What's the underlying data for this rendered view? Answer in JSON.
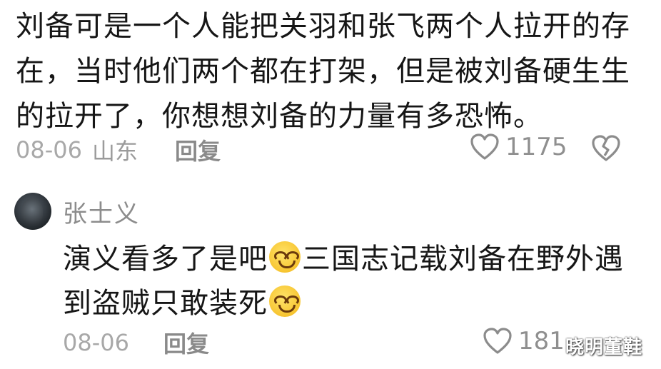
{
  "comment": {
    "text": "刘备可是一个人能把关羽和张飞两个人拉开的存在，当时他们两个都在打架，但是被刘备硬生生的拉开了，你想想刘备的力量有多恐怖。",
    "date": "08-06",
    "location": "山东",
    "reply_label": "回复",
    "like_count": "1175",
    "like_icon": "heart-outline-icon",
    "dislike_icon": "broken-heart-icon"
  },
  "reply": {
    "username": "张士义",
    "text_part1": "演义看多了是吧",
    "text_part2": "三国志记载刘备在野外遇到盗贼只敢装死",
    "emoji_icon": "grinning-emoji-icon",
    "date": "08-06",
    "reply_label": "回复",
    "like_count": "181",
    "like_icon": "heart-outline-icon"
  },
  "watermark": "晓明董鞋"
}
